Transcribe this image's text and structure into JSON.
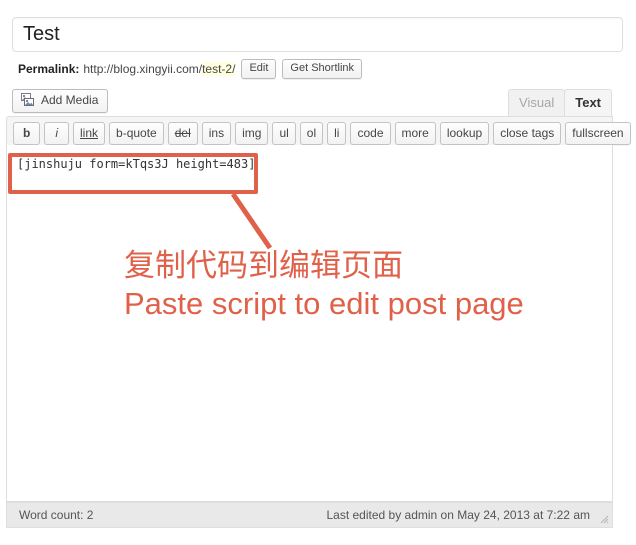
{
  "post_title": {
    "value": "Test",
    "placeholder": "Enter title here"
  },
  "permalink": {
    "label": "Permalink:",
    "base_url": "http://blog.xingyii.com/",
    "slug": "test-2/",
    "edit_button": "Edit",
    "shortlink_button": "Get Shortlink"
  },
  "media": {
    "add_media_label": "Add Media",
    "icon": "media-photos-icon"
  },
  "editor_tabs": [
    {
      "label": "Visual",
      "active": false
    },
    {
      "label": "Text",
      "active": true
    }
  ],
  "quicktags": [
    {
      "label": "b",
      "style": "qt-b"
    },
    {
      "label": "i",
      "style": "qt-i"
    },
    {
      "label": "link",
      "style": "qt-link"
    },
    {
      "label": "b-quote",
      "style": ""
    },
    {
      "label": "del",
      "style": "qt-del"
    },
    {
      "label": "ins",
      "style": ""
    },
    {
      "label": "img",
      "style": ""
    },
    {
      "label": "ul",
      "style": ""
    },
    {
      "label": "ol",
      "style": ""
    },
    {
      "label": "li",
      "style": ""
    },
    {
      "label": "code",
      "style": ""
    },
    {
      "label": "more",
      "style": ""
    },
    {
      "label": "lookup",
      "style": ""
    },
    {
      "label": "close tags",
      "style": ""
    },
    {
      "label": "fullscreen",
      "style": ""
    }
  ],
  "content": {
    "value": "[jinshuju form=kTqs3J height=483]"
  },
  "status_bar": {
    "word_count": "Word count: 2",
    "last_edited": "Last edited by admin on May 24, 2013 at 7:22 am"
  },
  "annotation": {
    "color": "#e0614a",
    "line_cn": "复制代码到编辑页面",
    "line_en": "Paste script to edit post page"
  }
}
